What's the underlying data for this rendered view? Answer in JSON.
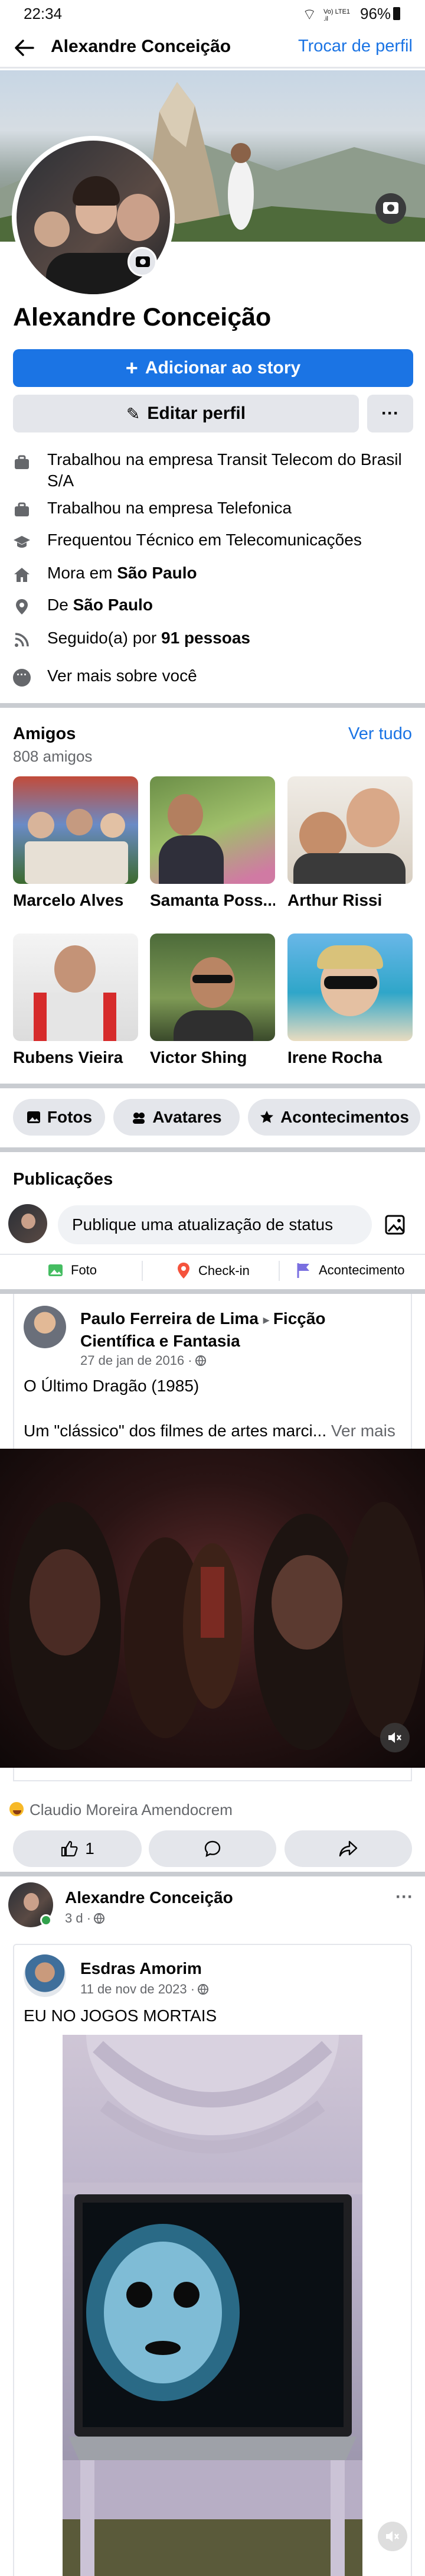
{
  "status_bar": {
    "time": "22:34",
    "network": "Vo) LTE1 .il",
    "battery": "96%"
  },
  "header": {
    "title": "Alexandre Conceição",
    "switch_profile": "Trocar de perfil"
  },
  "profile": {
    "name": "Alexandre Conceição",
    "add_story": "Adicionar ao story",
    "edit_profile": "Editar perfil",
    "more": "···"
  },
  "details": {
    "work1": "Trabalhou na empresa Transit Telecom do Brasil S/A",
    "work2": "Trabalhou na empresa Telefonica",
    "study": "Frequentou Técnico em Telecomunicações",
    "lives_prefix": "Mora em ",
    "lives_city": "São Paulo",
    "from_prefix": "De ",
    "from_city": "São Paulo",
    "followers_prefix": "Seguido(a) por ",
    "followers_count": "91 pessoas",
    "see_more": "Ver mais sobre você"
  },
  "friends": {
    "title": "Amigos",
    "count": "808 amigos",
    "see_all": "Ver tudo",
    "items": [
      {
        "name": "Marcelo Alves"
      },
      {
        "name": "Samanta Poss..."
      },
      {
        "name": "Arthur Rissi"
      },
      {
        "name": "Rubens Vieira"
      },
      {
        "name": "Victor Shing"
      },
      {
        "name": "Irene Rocha"
      }
    ]
  },
  "chips": {
    "photos": "Fotos",
    "avatars": "Avatares",
    "events": "Acontecimentos"
  },
  "publications": {
    "title": "Publicações",
    "composer_placeholder": "Publique uma atualização de status",
    "photo": "Foto",
    "checkin": "Check-in",
    "life_event": "Acontecimento"
  },
  "post1": {
    "author": "Paulo Ferreira de Lima",
    "group": "Ficção Científica e Fantasia",
    "date": "27 de jan de 2016 · ",
    "title": "O Último Dragão (1985)",
    "text": "Um \"clássico\" dos filmes de artes marci...",
    "see_more": "Ver mais",
    "reactor": "Claudio Moreira Amendocrem",
    "like_count": "1"
  },
  "post2": {
    "author": "Alexandre Conceição",
    "time": "3 d · ",
    "shared_author": "Esdras Amorim",
    "shared_date": "11 de nov de 2023 · ",
    "shared_text": "EU NO JOGOS MORTAIS"
  },
  "colors": {
    "accent": "#1b74e4",
    "text": "#050505",
    "muted": "#65676b",
    "chip": "#e4e6eb"
  }
}
